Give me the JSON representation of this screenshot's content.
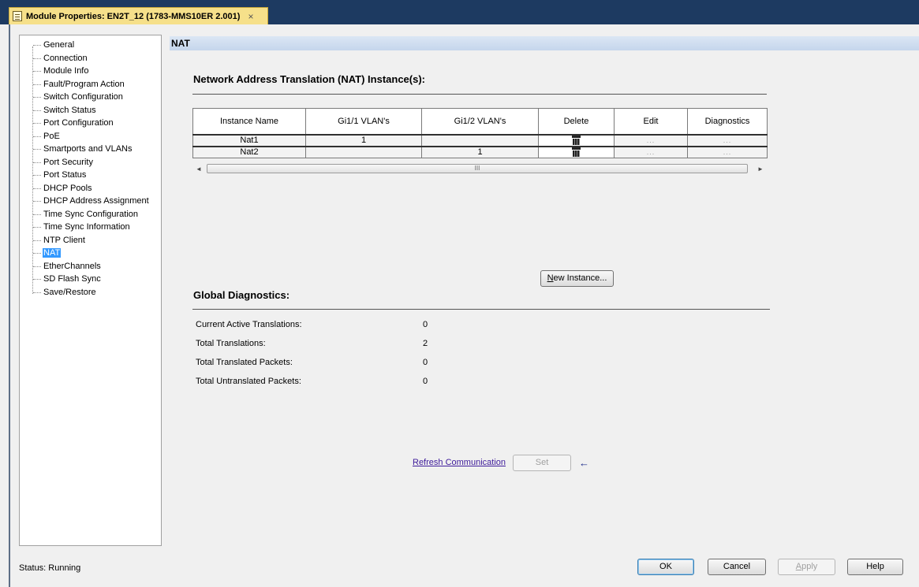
{
  "window": {
    "tab_title": "Module Properties: EN2T_12 (1783-MMS10ER 2.001)",
    "close_glyph": "×"
  },
  "sidebar": {
    "items": [
      {
        "label": "General"
      },
      {
        "label": "Connection"
      },
      {
        "label": "Module Info"
      },
      {
        "label": "Fault/Program Action"
      },
      {
        "label": "Switch Configuration"
      },
      {
        "label": "Switch Status"
      },
      {
        "label": "Port Configuration"
      },
      {
        "label": "PoE"
      },
      {
        "label": "Smartports and VLANs"
      },
      {
        "label": "Port Security"
      },
      {
        "label": "Port Status"
      },
      {
        "label": "DHCP Pools"
      },
      {
        "label": "DHCP Address Assignment"
      },
      {
        "label": "Time Sync Configuration"
      },
      {
        "label": "Time Sync Information"
      },
      {
        "label": "NTP Client"
      },
      {
        "label": "NAT",
        "selected": true
      },
      {
        "label": "EtherChannels"
      },
      {
        "label": "SD Flash Sync"
      },
      {
        "label": "Save/Restore"
      }
    ]
  },
  "section": {
    "title": "NAT"
  },
  "nat": {
    "heading": "Network Address Translation (NAT) Instance(s):",
    "columns": [
      "Instance Name",
      "Gi1/1 VLAN's",
      "Gi1/2 VLAN's",
      "Delete",
      "Edit",
      "Diagnostics"
    ],
    "rows": [
      {
        "name": "Nat1",
        "gi11": "1",
        "gi12": "",
        "edit": "...",
        "diagnostics": "..."
      },
      {
        "name": "Nat2",
        "gi11": "",
        "gi12": "1",
        "edit": "...",
        "diagnostics": "..."
      }
    ],
    "scroll_thumb_glyph": "III",
    "new_instance_button": "New Instance..."
  },
  "global_diagnostics": {
    "heading": "Global Diagnostics:",
    "items": [
      {
        "label": "Current Active Translations:",
        "value": "0"
      },
      {
        "label": "Total Translations:",
        "value": "2"
      },
      {
        "label": "Total Translated Packets:",
        "value": "0"
      },
      {
        "label": "Total Untranslated Packets:",
        "value": "0"
      }
    ]
  },
  "actions": {
    "refresh_link": "Refresh Communication",
    "set_button": "Set"
  },
  "footer": {
    "status": "Status:  Running",
    "ok": "OK",
    "cancel": "Cancel",
    "apply": "Apply",
    "help": "Help"
  }
}
